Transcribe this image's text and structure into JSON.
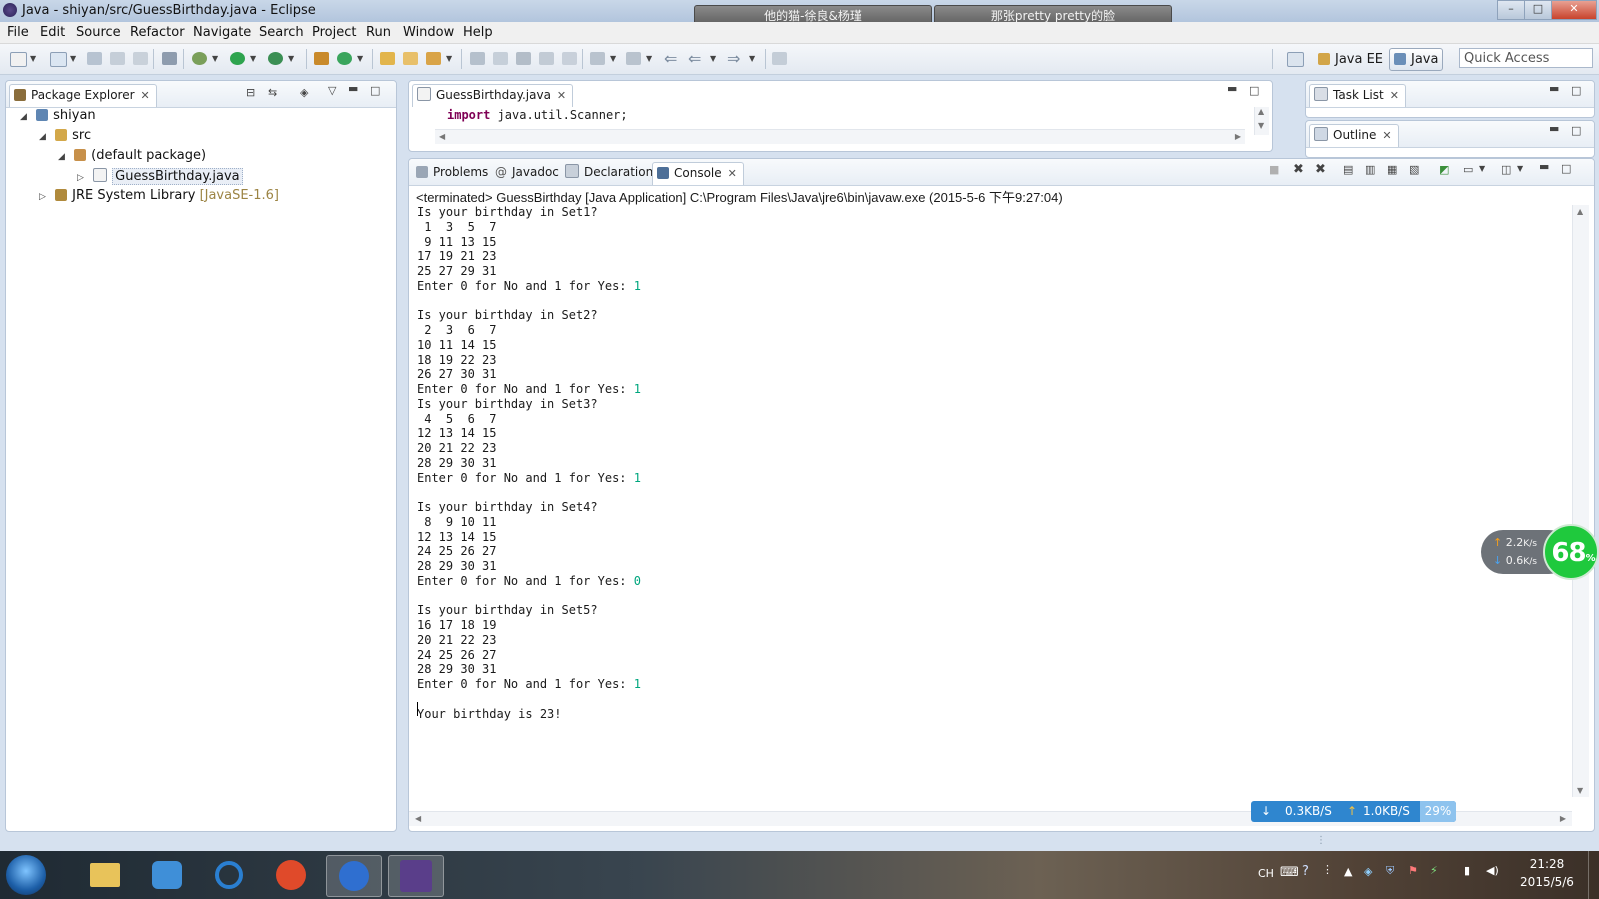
{
  "window": {
    "title": "Java - shiyan/src/GuessBirthday.java - Eclipse",
    "music_tabs": [
      "他的猫-徐良&杨瑾",
      "那张pretty pretty的脸"
    ],
    "controls": {
      "minimize": "–",
      "maximize": "□",
      "close": "✕"
    }
  },
  "menu": [
    "File",
    "Edit",
    "Source",
    "Refactor",
    "Navigate",
    "Search",
    "Project",
    "Run",
    "Window",
    "Help"
  ],
  "toolbar": {
    "perspectives": [
      "Java EE",
      "Java"
    ],
    "quick_access": "Quick Access"
  },
  "package_explorer": {
    "tab": "Package Explorer",
    "tree": [
      {
        "label": "shiyan",
        "level": 0,
        "twisty": "◢"
      },
      {
        "label": "src",
        "level": 1,
        "twisty": "◢"
      },
      {
        "label": "(default package)",
        "level": 2,
        "twisty": "◢"
      },
      {
        "label": "GuessBirthday.java",
        "level": 3,
        "twisty": "▷"
      },
      {
        "label": "JRE System Library",
        "decoration": "[JavaSE-1.6]",
        "level": 1,
        "twisty": "▷"
      }
    ]
  },
  "editor": {
    "tab": "GuessBirthday.java",
    "code_keyword": "import",
    "code_rest": " java.util.Scanner;"
  },
  "task_list": {
    "tab": "Task List"
  },
  "outline": {
    "tab": "Outline"
  },
  "bottom_tabs": [
    "Problems",
    "Javadoc",
    "Declaration",
    "Console"
  ],
  "console": {
    "header": "<terminated> GuessBirthday [Java Application] C:\\Program Files\\Java\\jre6\\bin\\javaw.exe (2015-5-6 下午9:27:04)",
    "lines": [
      {
        "text": "Is your birthday in Set1?",
        "input": ""
      },
      {
        "text": " 1  3  5  7",
        "input": ""
      },
      {
        "text": " 9 11 13 15",
        "input": ""
      },
      {
        "text": "17 19 21 23",
        "input": ""
      },
      {
        "text": "25 27 29 31",
        "input": ""
      },
      {
        "text": "Enter 0 for No and 1 for Yes: ",
        "input": "1"
      },
      {
        "text": "",
        "input": ""
      },
      {
        "text": "Is your birthday in Set2?",
        "input": ""
      },
      {
        "text": " 2  3  6  7",
        "input": ""
      },
      {
        "text": "10 11 14 15",
        "input": ""
      },
      {
        "text": "18 19 22 23",
        "input": ""
      },
      {
        "text": "26 27 30 31",
        "input": ""
      },
      {
        "text": "Enter 0 for No and 1 for Yes: ",
        "input": "1"
      },
      {
        "text": "Is your birthday in Set3?",
        "input": ""
      },
      {
        "text": " 4  5  6  7",
        "input": ""
      },
      {
        "text": "12 13 14 15",
        "input": ""
      },
      {
        "text": "20 21 22 23",
        "input": ""
      },
      {
        "text": "28 29 30 31",
        "input": ""
      },
      {
        "text": "Enter 0 for No and 1 for Yes: ",
        "input": "1"
      },
      {
        "text": "",
        "input": ""
      },
      {
        "text": "Is your birthday in Set4?",
        "input": ""
      },
      {
        "text": " 8  9 10 11",
        "input": ""
      },
      {
        "text": "12 13 14 15",
        "input": ""
      },
      {
        "text": "24 25 26 27",
        "input": ""
      },
      {
        "text": "28 29 30 31",
        "input": ""
      },
      {
        "text": "Enter 0 for No and 1 for Yes: ",
        "input": "0"
      },
      {
        "text": "",
        "input": ""
      },
      {
        "text": "Is your birthday in Set5?",
        "input": ""
      },
      {
        "text": "16 17 18 19",
        "input": ""
      },
      {
        "text": "20 21 22 23",
        "input": ""
      },
      {
        "text": "24 25 26 27",
        "input": ""
      },
      {
        "text": "28 29 30 31",
        "input": ""
      },
      {
        "text": "Enter 0 for No and 1 for Yes: ",
        "input": "1"
      },
      {
        "text": "",
        "input": ""
      },
      {
        "text": "Your birthday is 23!",
        "input": ""
      }
    ]
  },
  "net_monitor": {
    "up": "2.2",
    "down": "0.6",
    "unit": "K/s",
    "percent": "68",
    "percent_sign": "%"
  },
  "transfer_status": {
    "down": "0.3KB/S",
    "up": "1.0KB/S",
    "percent": "29%"
  },
  "taskbar": {
    "time": "21:28",
    "date": "2015/5/6",
    "input_method": "CH",
    "apps": [
      "start-orb",
      "explorer",
      "qq-pinyin",
      "internet-explorer",
      "media-player",
      "sogou",
      "java-ee-ide"
    ]
  },
  "colors": {
    "console_input": "#00a67e",
    "keyword": "#7f0055",
    "decoration": "#9c8444",
    "net_ring": "#1fc93d"
  }
}
